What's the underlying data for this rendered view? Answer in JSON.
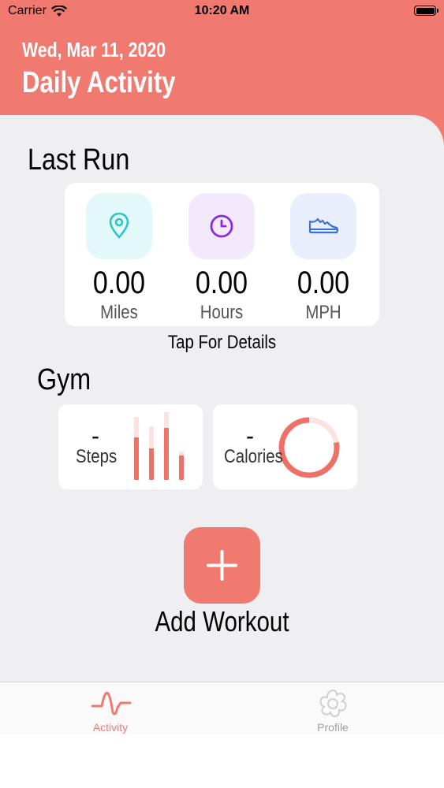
{
  "status_bar": {
    "carrier": "Carrier",
    "time": "10:20 AM"
  },
  "header": {
    "date": "Wed, Mar 11, 2020",
    "title": "Daily Activity"
  },
  "last_run": {
    "title": "Last Run",
    "metrics": [
      {
        "icon": "location-pin-icon",
        "value": "0.00",
        "unit": "Miles",
        "color": "#2ec4c8",
        "bg": "#e3f8f8"
      },
      {
        "icon": "clock-icon",
        "value": "0.00",
        "unit": "Hours",
        "color": "#8a2be2",
        "bg": "#f2e9fb"
      },
      {
        "icon": "sneaker-icon",
        "value": "0.00",
        "unit": "MPH",
        "color": "#3d6fd6",
        "bg": "#e8eefb"
      }
    ],
    "tap_details": "Tap For Details"
  },
  "gym": {
    "title": "Gym",
    "steps": {
      "value": "-",
      "label": "Steps",
      "bars": [
        0.67,
        0.5,
        0.83,
        0.39
      ]
    },
    "calories": {
      "value": "-",
      "label": "Calories",
      "progress": 0.78
    }
  },
  "add_workout": {
    "label": "Add Workout"
  },
  "tab_bar": {
    "tabs": [
      {
        "label": "Activity",
        "icon": "heartbeat-icon",
        "active": true
      },
      {
        "label": "Profile",
        "icon": "gear-flower-icon",
        "active": false
      }
    ]
  },
  "colors": {
    "accent": "#f07a70",
    "inactive": "#a0a0a0"
  }
}
